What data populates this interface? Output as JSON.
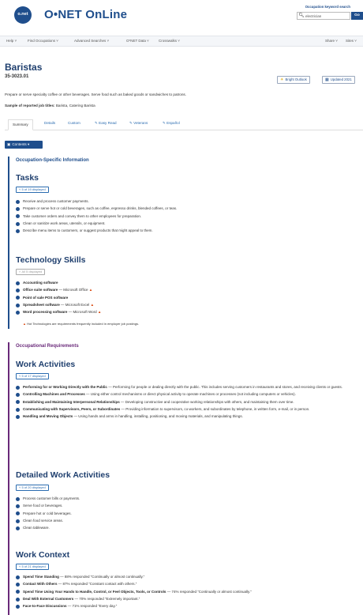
{
  "header": {
    "logo_badge": "o.net",
    "logo_text": "O•NET OnLine",
    "keyword_label": "Occupation keyword search",
    "search_value": "electrician",
    "go_label": "Go"
  },
  "nav": {
    "items": [
      "Help ˅",
      "Find Occupations ˅",
      "Advanced Searches ˅",
      "O*NET Data ˅",
      "Crosswalks ˅"
    ],
    "right": [
      "Share ˅",
      "Sites ˅"
    ]
  },
  "occupation": {
    "title": "Baristas",
    "code": "35-3023.01",
    "bright_outlook": "Bright Outlook",
    "updated": "Updated 2021",
    "description": "Prepare or serve specialty coffee or other beverages. Serve food such as baked goods or sandwiches to patrons.",
    "sample_label": "Sample of reported job titles:",
    "sample_titles": " Barista, Catering Barista"
  },
  "tabs": [
    "Summary",
    "Details",
    "Custom",
    "Easy Read",
    "Veterans",
    "Español"
  ],
  "contents_label": "Contents ▾",
  "sections": {
    "occ_specific": "Occupation-Specific Information",
    "occ_requirements": "Occupational Requirements"
  },
  "tasks": {
    "heading": "Tasks",
    "displayed": "5 of 19 displayed",
    "items": [
      "Receive and process customer payments.",
      "Prepare or serve hot or cold beverages, such as coffee, espresso drinks, blended coffees, or teas.",
      "Take customer orders and convey them to other employees for preparation.",
      "Clean or sanitize work areas, utensils, or equipment.",
      "Describe menu items to customers, or suggest products that might appeal to them."
    ]
  },
  "technology": {
    "heading": "Technology Skills",
    "displayed": "All 5 displayed",
    "items": [
      {
        "name": "Accounting software",
        "example": "",
        "hot": false
      },
      {
        "name": "Office suite software",
        "example": " — Microsoft Office",
        "hot": true
      },
      {
        "name": "Point of sale POS software",
        "example": "",
        "hot": false
      },
      {
        "name": "Spreadsheet software",
        "example": " — Microsoft Excel",
        "hot": true
      },
      {
        "name": "Word processing software",
        "example": " — Microsoft Word",
        "hot": true
      }
    ],
    "hot_note": " Hot Technologies are requirements frequently included in employer job postings."
  },
  "work_activities": {
    "heading": "Work Activities",
    "displayed": "5 of 17 displayed",
    "items": [
      {
        "title": "Performing for or Working Directly with the Public",
        "desc": " — Performing for people or dealing directly with the public. This includes serving customers in restaurants and stores, and receiving clients or guests."
      },
      {
        "title": "Controlling Machines and Processes",
        "desc": " — Using either control mechanisms or direct physical activity to operate machines or processes (not including computers or vehicles)."
      },
      {
        "title": "Establishing and Maintaining Interpersonal Relationships",
        "desc": " — Developing constructive and cooperative working relationships with others, and maintaining them over time."
      },
      {
        "title": "Communicating with Supervisors, Peers, or Subordinates",
        "desc": " — Providing information to supervisors, co-workers, and subordinates by telephone, in written form, e-mail, or in person."
      },
      {
        "title": "Handling and Moving Objects",
        "desc": " — Using hands and arms in handling, installing, positioning, and moving materials, and manipulating things."
      }
    ]
  },
  "detailed_activities": {
    "heading": "Detailed Work Activities",
    "displayed": "5 of 20 displayed",
    "items": [
      "Process customer bills or payments.",
      "Serve food or beverages.",
      "Prepare hot or cold beverages.",
      "Clean food service areas.",
      "Clean tableware."
    ]
  },
  "work_context": {
    "heading": "Work Context",
    "displayed": "5 of 21 displayed",
    "items": [
      {
        "title": "Spend Time Standing",
        "desc": " — 88% responded “Continually or almost continually.”"
      },
      {
        "title": "Contact With Others",
        "desc": " — 87% responded “Constant contact with others.”"
      },
      {
        "title": "Spend Time Using Your Hands to Handle, Control, or Feel Objects, Tools, or Controls",
        "desc": " — 74% responded “Continually or almost continually.”"
      },
      {
        "title": "Deal With External Customers",
        "desc": " — 70% responded “Extremely important.”"
      },
      {
        "title": "Face-to-Face Discussions",
        "desc": " — 71% responded “Every day.”"
      }
    ]
  }
}
